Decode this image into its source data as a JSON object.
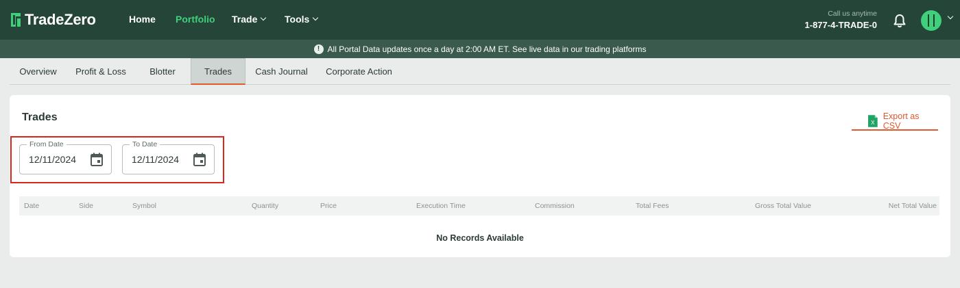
{
  "brand": {
    "name": "TradeZero",
    "accent": "#3ed07a",
    "header_bg": "#244538",
    "banner_bg": "#3a5a4d",
    "orange": "#e0582b",
    "highlight": "#d9261c"
  },
  "nav": {
    "home": "Home",
    "portfolio": "Portfolio",
    "trade": "Trade",
    "tools": "Tools"
  },
  "contact": {
    "label": "Call us anytime",
    "number": "1-877-4-TRADE-0"
  },
  "icons": {
    "notifications": "bell-icon",
    "profile": "avatar-icon",
    "info": "exclamation-icon",
    "export": "excel-icon",
    "calendar": "calendar-icon"
  },
  "banner": {
    "icon": "!",
    "text": "All Portal Data updates once a day at 2:00 AM ET. See live data in our trading platforms"
  },
  "tabs": [
    "Overview",
    "Profit & Loss",
    "Blotter",
    "Trades",
    "Cash Journal",
    "Corporate Action"
  ],
  "active_tab": "Trades",
  "trades": {
    "title": "Trades",
    "export_label": "Export as CSV",
    "export_icon_letter": "X",
    "from_date": {
      "label": "From Date",
      "value": "12/11/2024"
    },
    "to_date": {
      "label": "To Date",
      "value": "12/11/2024"
    },
    "columns": [
      "Date",
      "Side",
      "Symbol",
      "Quantity",
      "Price",
      "Execution Time",
      "Commission",
      "Total Fees",
      "Gross Total Value",
      "Net Total Value"
    ],
    "empty_message": "No Records Available"
  }
}
